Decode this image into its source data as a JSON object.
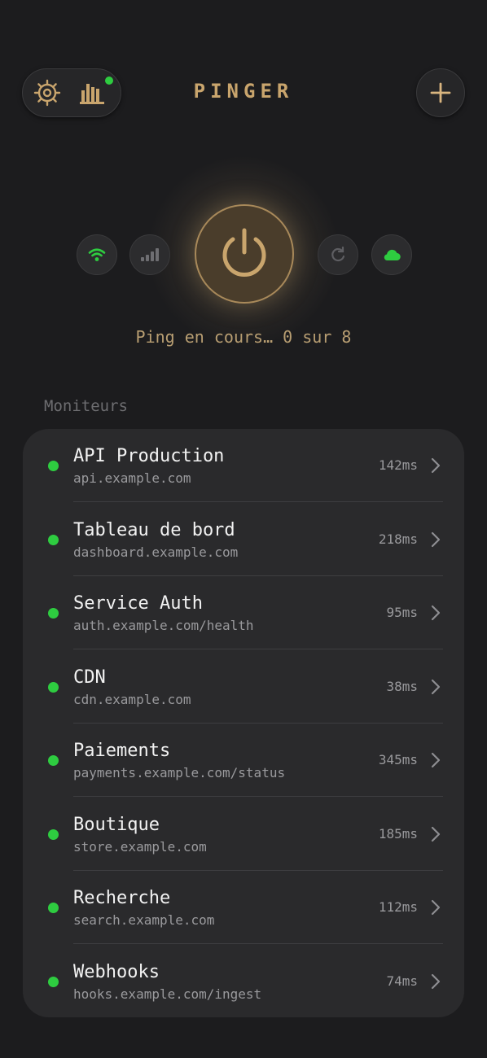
{
  "app": {
    "title": "PINGER"
  },
  "header": {
    "settings_icon": "gear-icon",
    "stats_icon": "bar-chart-icon",
    "add_icon": "plus-icon"
  },
  "controls": {
    "wifi_icon": "wifi-icon",
    "signal_icon": "cellular-signal-icon",
    "power_icon": "power-icon",
    "refresh_icon": "refresh-icon",
    "cloud_icon": "cloud-icon"
  },
  "status": {
    "text": "Ping en cours… 0 sur 8"
  },
  "monitors": {
    "label": "Moniteurs",
    "items": [
      {
        "name": "API Production",
        "url": "api.example.com",
        "latency": "142ms",
        "state": "up"
      },
      {
        "name": "Tableau de bord",
        "url": "dashboard.example.com",
        "latency": "218ms",
        "state": "up"
      },
      {
        "name": "Service Auth",
        "url": "auth.example.com/health",
        "latency": "95ms",
        "state": "up"
      },
      {
        "name": "CDN",
        "url": "cdn.example.com",
        "latency": "38ms",
        "state": "up"
      },
      {
        "name": "Paiements",
        "url": "payments.example.com/status",
        "latency": "345ms",
        "state": "up"
      },
      {
        "name": "Boutique",
        "url": "store.example.com",
        "latency": "185ms",
        "state": "up"
      },
      {
        "name": "Recherche",
        "url": "search.example.com",
        "latency": "112ms",
        "state": "up"
      },
      {
        "name": "Webhooks",
        "url": "hooks.example.com/ingest",
        "latency": "74ms",
        "state": "up"
      }
    ]
  },
  "colors": {
    "background": "#1c1c1e",
    "accent": "#c9a56d",
    "status_up": "#2ecc40",
    "card": "#2a2a2c"
  }
}
